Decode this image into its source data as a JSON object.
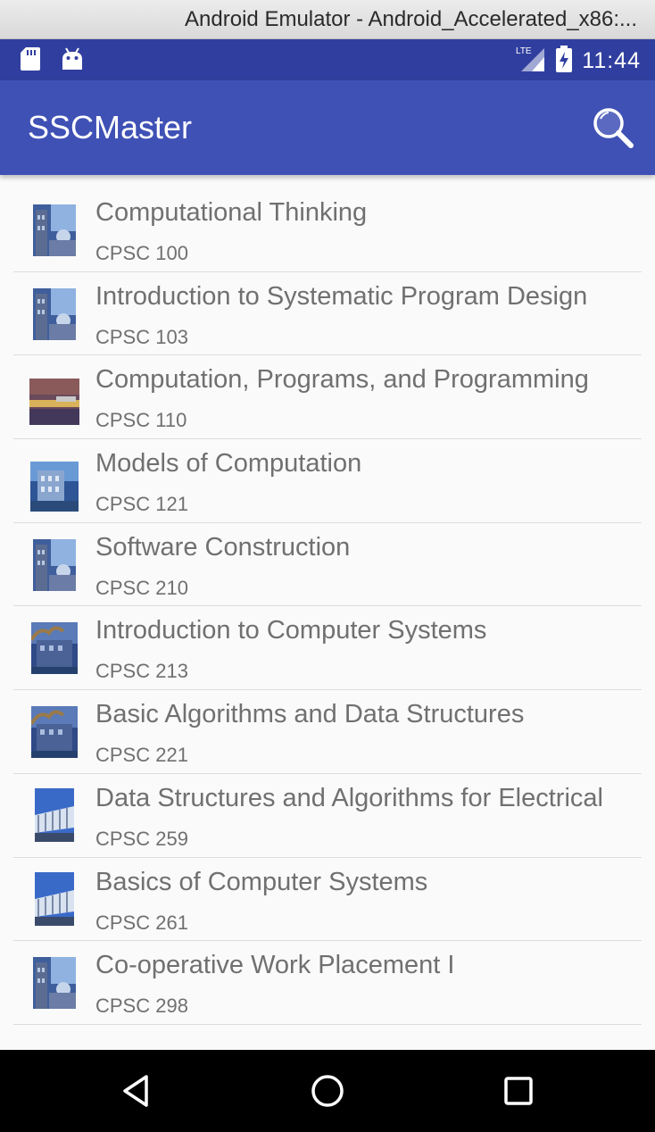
{
  "window": {
    "title": "Android Emulator - Android_Accelerated_x86:..."
  },
  "status_bar": {
    "time": "11:44",
    "network_label": "LTE",
    "left_icons": [
      "sd-card-icon",
      "android-icon"
    ],
    "right_icons": [
      "signal-icon",
      "battery-charging-icon"
    ]
  },
  "app_bar": {
    "title": "SSCMaster",
    "action_icon": "search-icon"
  },
  "courses": [
    {
      "title": "Computational Thinking",
      "code": "CPSC 100"
    },
    {
      "title": "Introduction to Systematic Program Design",
      "code": "CPSC 103"
    },
    {
      "title": "Computation, Programs, and Programming",
      "code": "CPSC 110"
    },
    {
      "title": "Models of Computation",
      "code": "CPSC 121"
    },
    {
      "title": "Software Construction",
      "code": "CPSC 210"
    },
    {
      "title": "Introduction to Computer Systems",
      "code": "CPSC 213"
    },
    {
      "title": "Basic Algorithms and Data Structures",
      "code": "CPSC 221"
    },
    {
      "title": "Data Structures and Algorithms for Electrical",
      "code": "CPSC 259"
    },
    {
      "title": "Basics of Computer Systems",
      "code": "CPSC 261"
    },
    {
      "title": "Co-operative Work Placement I",
      "code": "CPSC 298"
    }
  ],
  "nav_bar": {
    "buttons": [
      "back-icon",
      "home-icon",
      "recents-icon"
    ]
  },
  "colors": {
    "status_bar": "#303f9f",
    "app_bar": "#3f51b5",
    "list_text": "#707070"
  }
}
